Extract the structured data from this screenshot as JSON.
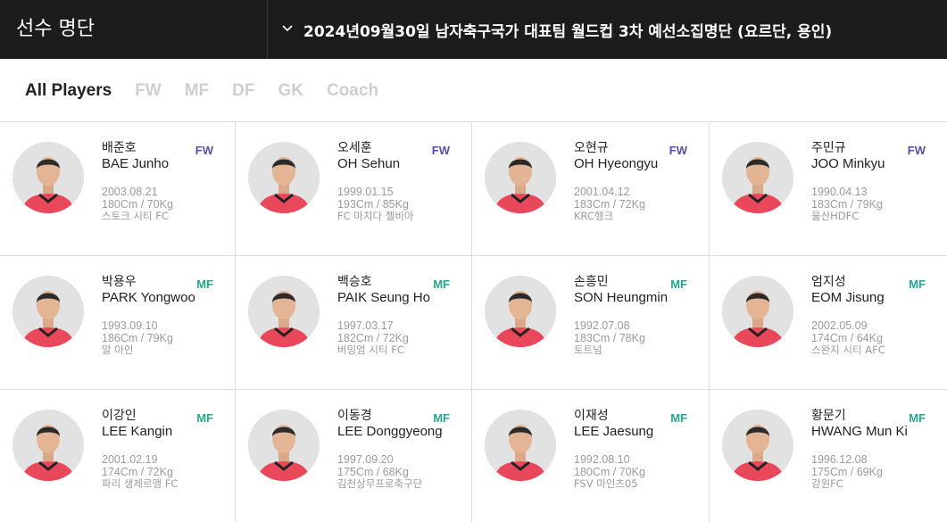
{
  "header": {
    "title": "선수 명단",
    "selection": "2024년09월30일 남자축구국가 대표팀 월드컵 3차 예선소집명단 (요르단, 용인)"
  },
  "tabs": [
    {
      "label": "All Players",
      "active": true
    },
    {
      "label": "FW",
      "active": false
    },
    {
      "label": "MF",
      "active": false
    },
    {
      "label": "DF",
      "active": false
    },
    {
      "label": "GK",
      "active": false
    },
    {
      "label": "Coach",
      "active": false
    }
  ],
  "colors": {
    "header_bg": "#1c1c1c",
    "fw": "#5a4fa8",
    "mf": "#2aa48c",
    "jersey": "#e8485a",
    "muted": "#9a9a9a"
  },
  "players": [
    {
      "name_ko": "배준호",
      "name_en": "BAE Junho",
      "position": "FW",
      "birth": "2003.08.21",
      "body": "180Cm / 70Kg",
      "club": "스토크 시티 FC"
    },
    {
      "name_ko": "오세훈",
      "name_en": "OH Sehun",
      "position": "FW",
      "birth": "1999.01.15",
      "body": "193Cm / 85Kg",
      "club": "FC 마치다 젤비아"
    },
    {
      "name_ko": "오현규",
      "name_en": "OH Hyeongyu",
      "position": "FW",
      "birth": "2001.04.12",
      "body": "183Cm / 72Kg",
      "club": "KRC헹크"
    },
    {
      "name_ko": "주민규",
      "name_en": "JOO Minkyu",
      "position": "FW",
      "birth": "1990.04.13",
      "body": "183Cm / 79Kg",
      "club": "울산HDFC"
    },
    {
      "name_ko": "박용우",
      "name_en": "PARK Yongwoo",
      "position": "MF",
      "birth": "1993.09.10",
      "body": "186Cm / 79Kg",
      "club": "알 아인"
    },
    {
      "name_ko": "백승호",
      "name_en": "PAIK Seung Ho",
      "position": "MF",
      "birth": "1997.03.17",
      "body": "182Cm / 72Kg",
      "club": "버밍엄 시티 FC"
    },
    {
      "name_ko": "손흥민",
      "name_en": "SON Heungmin",
      "position": "MF",
      "birth": "1992.07.08",
      "body": "183Cm / 78Kg",
      "club": "토트넘"
    },
    {
      "name_ko": "엄지성",
      "name_en": "EOM Jisung",
      "position": "MF",
      "birth": "2002.05.09",
      "body": "174Cm / 64Kg",
      "club": "스완지 시티 AFC"
    },
    {
      "name_ko": "이강인",
      "name_en": "LEE Kangin",
      "position": "MF",
      "birth": "2001.02.19",
      "body": "174Cm / 72Kg",
      "club": "파리 생제르맹 FC"
    },
    {
      "name_ko": "이동경",
      "name_en": "LEE Donggyeong",
      "position": "MF",
      "birth": "1997.09.20",
      "body": "175Cm / 68Kg",
      "club": "김천상무프로축구단"
    },
    {
      "name_ko": "이재성",
      "name_en": "LEE Jaesung",
      "position": "MF",
      "birth": "1992.08.10",
      "body": "180Cm / 70Kg",
      "club": "FSV 마인츠05"
    },
    {
      "name_ko": "황문기",
      "name_en": "HWANG Mun Ki",
      "position": "MF",
      "birth": "1996.12.08",
      "body": "175Cm / 69Kg",
      "club": "강원FC"
    }
  ]
}
